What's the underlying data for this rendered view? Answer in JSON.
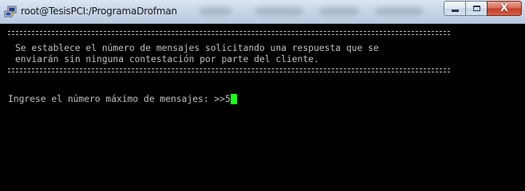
{
  "window": {
    "title": "root@TesisPCI:/ProgramaDrofman",
    "app_icon": "putty-icon",
    "minimize_icon": "minimize-icon",
    "maximize_icon": "maximize-icon",
    "close_icon": "close-icon",
    "close_glyph": "X"
  },
  "terminal": {
    "message_lines": [
      "Se establece el número de mensajes solicitando una respuesta que se",
      "enviarán sin ninguna contestación por parte del cliente."
    ],
    "prompt": "Ingrese el número máximo de mensajes: >>",
    "input_value": "5",
    "colors": {
      "background": "#000000",
      "text": "#c0c0c0",
      "cursor": "#1aff1a"
    }
  }
}
